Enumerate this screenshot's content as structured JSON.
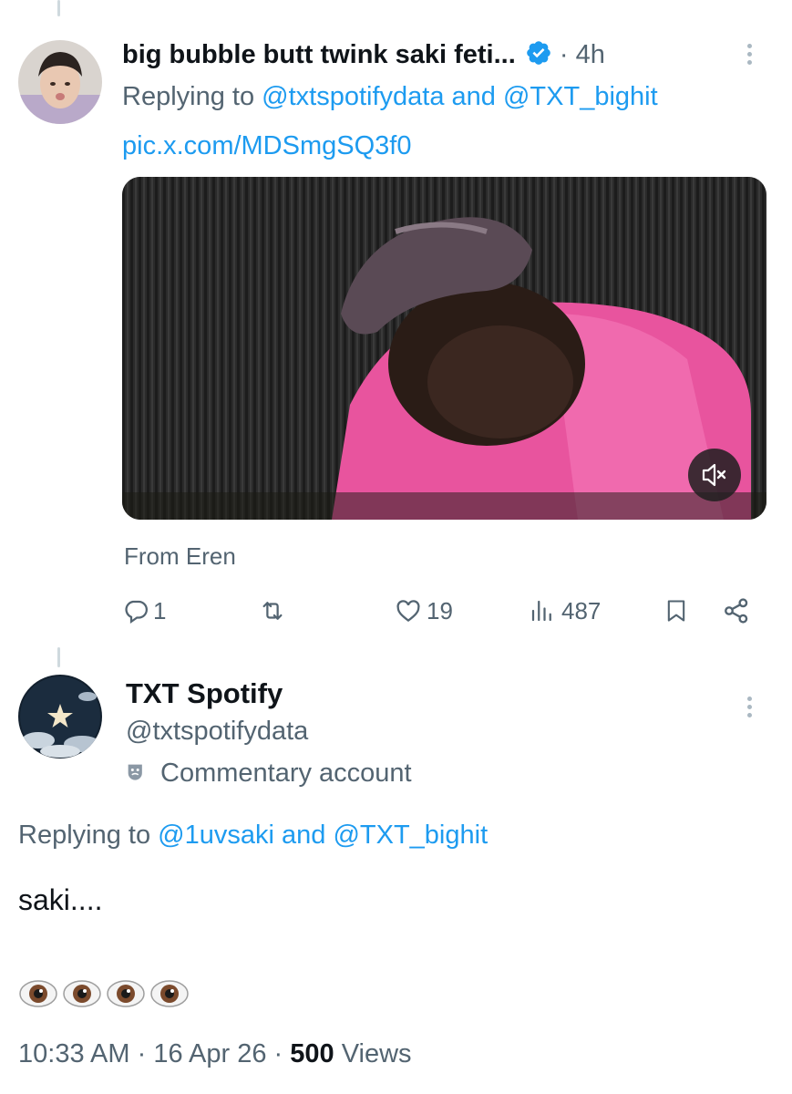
{
  "tweet1": {
    "author_name": "big bubble butt twink saki feti...",
    "time": "4h",
    "replying_prefix": "Replying to",
    "reply_handle_1": "@txtspotifydata",
    "reply_and": "and",
    "reply_handle_2": "@TXT_bighit",
    "pic_link": "pic.x.com/MDSmgSQ3f0",
    "source": "From Eren",
    "reply_count": "1",
    "like_count": "19",
    "view_count": "487"
  },
  "tweet2": {
    "author_name": "TXT Spotify",
    "handle": "@txtspotifydata",
    "label": "Commentary account",
    "replying_prefix": "Replying to",
    "reply_handle_1": "@1uvsaki",
    "reply_and": "and",
    "reply_handle_2": "@TXT_bighit",
    "text": "saki....",
    "time": "10:33 AM",
    "date": "16 Apr 26",
    "views_count": "500",
    "views_label": "Views"
  },
  "colors": {
    "accent": "#1d9bf0",
    "secondary_text": "#536471",
    "primary_text": "#0f1419"
  }
}
